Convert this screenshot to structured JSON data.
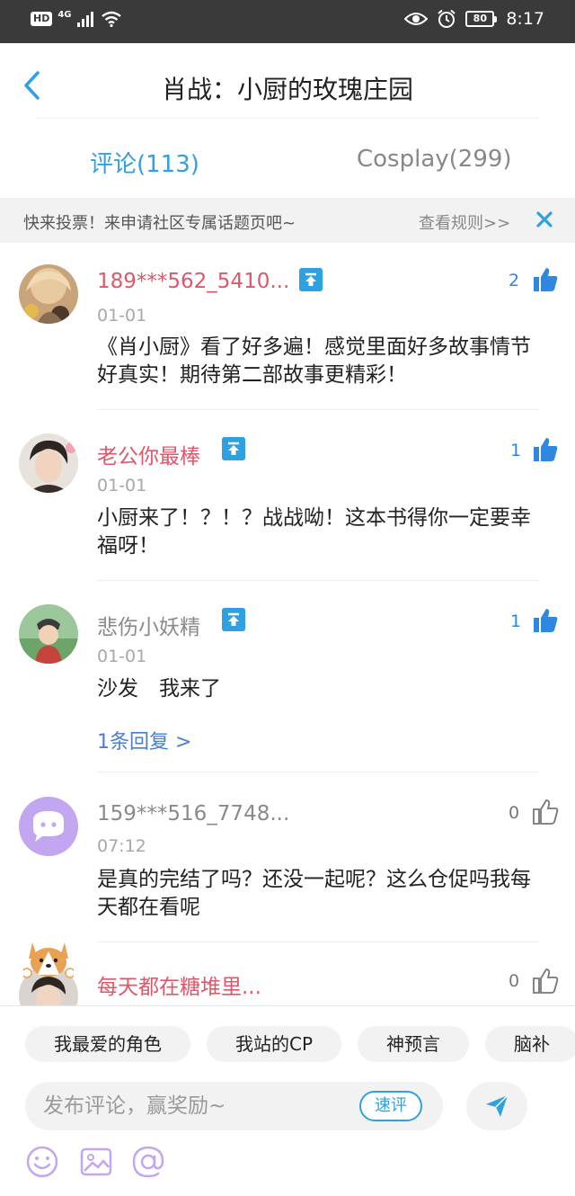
{
  "status_bar": {
    "hd": "HD",
    "network": "4G",
    "battery": "80",
    "time": "8:17"
  },
  "header": {
    "title": "肖战：小厨的玫瑰庄园"
  },
  "tabs": [
    {
      "label": "评论(113)"
    },
    {
      "label": "Cosplay(299)"
    }
  ],
  "notice": {
    "text": "快来投票！来申请社区专属话题页吧~",
    "rules": "查看规则>>"
  },
  "comments": [
    {
      "user": "189***562_5410...",
      "date": "01-01",
      "likes": "2",
      "text": "《肖小厨》看了好多遍！感觉里面好多故事情节好真实！期待第二部故事更精彩！"
    },
    {
      "user": "老公你最棒",
      "date": "01-01",
      "likes": "1",
      "text": "小厨来了！？！？战战呦！这本书得你一定要幸福呀！"
    },
    {
      "user": "悲伤小妖精",
      "date": "01-01",
      "likes": "1",
      "text": "沙发　我来了",
      "replies": "1条回复 >"
    },
    {
      "user": "159***516_7748...",
      "date": "07:12",
      "likes": "0",
      "text": "是真的完结了吗？还没一起呢？这么仓促吗我每天都在看呢"
    },
    {
      "user": "每天都在糖堆里...",
      "likes": "0"
    }
  ],
  "composer": {
    "tags": [
      "我最爱的角色",
      "我站的CP",
      "神预言",
      "脑补"
    ],
    "placeholder": "发布评论，赢奖励~",
    "quick_review": "速评"
  },
  "colors": {
    "accent": "#2fa0e0",
    "username_red": "#e0566a",
    "like_blue": "#2f87e0"
  }
}
